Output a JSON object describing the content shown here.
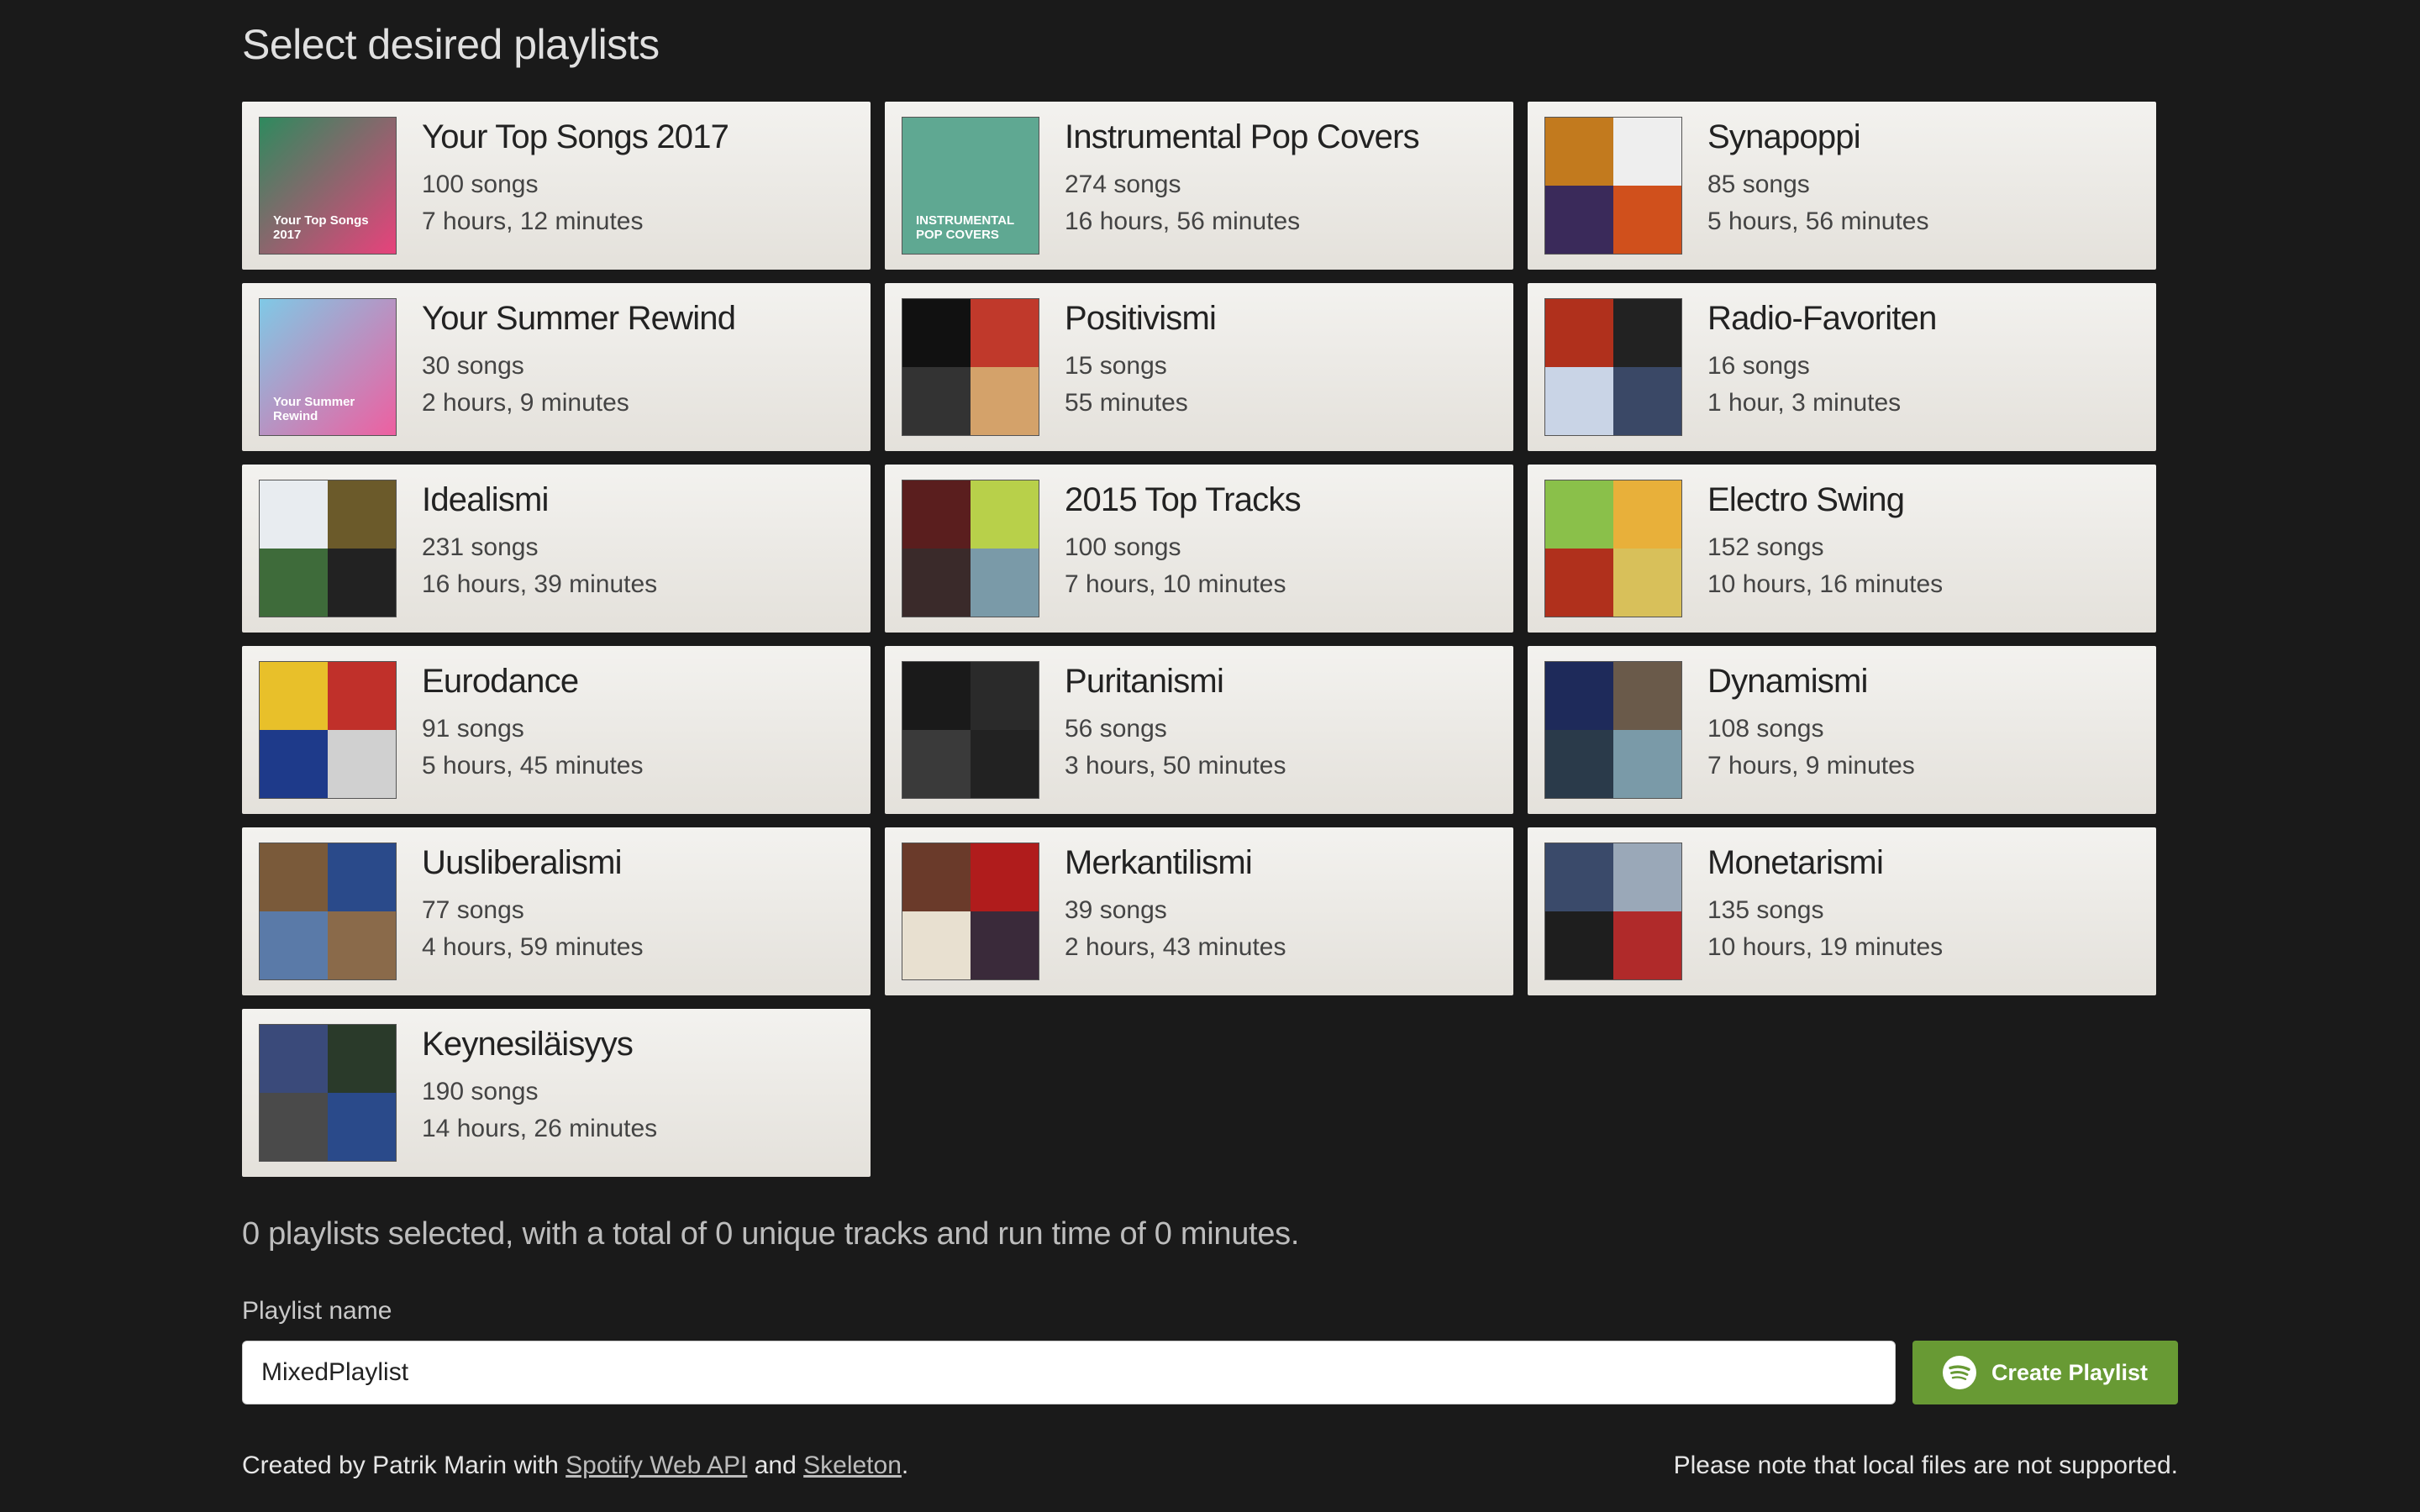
{
  "page": {
    "title": "Select desired playlists"
  },
  "playlists": [
    {
      "name": "Your Top Songs 2017",
      "songs": "100 songs",
      "duration": "7 hours, 12 minutes",
      "cover_text": "Your Top Songs 2017",
      "colors": [
        "#2e8a5e",
        "#e8427c",
        "#1d6b47",
        "#f07ba2"
      ]
    },
    {
      "name": "Instrumental Pop Covers",
      "songs": "274 songs",
      "duration": "16 hours, 56 minutes",
      "cover_text": "INSTRUMENTAL POP COVERS",
      "colors": [
        "#5fa892",
        "#5fa892",
        "#5fa892",
        "#5fa892"
      ]
    },
    {
      "name": "Synapoppi",
      "songs": "85 songs",
      "duration": "5 hours, 56 minutes",
      "colors": [
        "#c27a1e",
        "#eeeeee",
        "#3a2a5a",
        "#d0501c"
      ]
    },
    {
      "name": "Your Summer Rewind",
      "songs": "30 songs",
      "duration": "2 hours, 9 minutes",
      "cover_text": "Your Summer Rewind",
      "colors": [
        "#7fc9e6",
        "#ee5fa0",
        "#9fd6ee",
        "#f4a3c4"
      ]
    },
    {
      "name": "Positivismi",
      "songs": "15 songs",
      "duration": "55 minutes",
      "colors": [
        "#111111",
        "#c0392b",
        "#333333",
        "#d4a26a"
      ]
    },
    {
      "name": "Radio-Favoriten",
      "songs": "16 songs",
      "duration": "1 hour, 3 minutes",
      "colors": [
        "#b0301c",
        "#222222",
        "#c9d4e6",
        "#3a4866"
      ]
    },
    {
      "name": "Idealismi",
      "songs": "231 songs",
      "duration": "16 hours, 39 minutes",
      "colors": [
        "#e8ecf0",
        "#6b5a2a",
        "#3e6b3a",
        "#222222"
      ]
    },
    {
      "name": "2015 Top Tracks",
      "songs": "100 songs",
      "duration": "7 hours, 10 minutes",
      "colors": [
        "#5a1e1e",
        "#b8d04a",
        "#3a2a2a",
        "#7a9aa8"
      ]
    },
    {
      "name": "Electro Swing",
      "songs": "152 songs",
      "duration": "10 hours, 16 minutes",
      "colors": [
        "#8ac04a",
        "#e8b03a",
        "#b0301c",
        "#d8c05a"
      ]
    },
    {
      "name": "Eurodance",
      "songs": "91 songs",
      "duration": "5 hours, 45 minutes",
      "colors": [
        "#e8c02a",
        "#c0302a",
        "#1e3a8a",
        "#d0d0d0"
      ]
    },
    {
      "name": "Puritanismi",
      "songs": "56 songs",
      "duration": "3 hours, 50 minutes",
      "colors": [
        "#1a1a1a",
        "#2a2a2a",
        "#3a3a3a",
        "#222222"
      ]
    },
    {
      "name": "Dynamismi",
      "songs": "108 songs",
      "duration": "7 hours, 9 minutes",
      "colors": [
        "#1e2a5a",
        "#6a5a4a",
        "#2a3a4a",
        "#7a9aa8"
      ]
    },
    {
      "name": "Uusliberalismi",
      "songs": "77 songs",
      "duration": "4 hours, 59 minutes",
      "colors": [
        "#7a5a3a",
        "#2a4a8a",
        "#5a7aa8",
        "#8a6a4a"
      ]
    },
    {
      "name": "Merkantilismi",
      "songs": "39 songs",
      "duration": "2 hours, 43 minutes",
      "colors": [
        "#6a3a2a",
        "#b01c1c",
        "#e8e0d0",
        "#3a2a3a"
      ]
    },
    {
      "name": "Monetarismi",
      "songs": "135 songs",
      "duration": "10 hours, 19 minutes",
      "colors": [
        "#3a4a6a",
        "#9aa8b8",
        "#1e1e1e",
        "#b02a2a"
      ]
    },
    {
      "name": "Keynesiläisyys",
      "songs": "190 songs",
      "duration": "14 hours, 26 minutes",
      "colors": [
        "#3a4a7a",
        "#2a3a2a",
        "#4a4a4a",
        "#2a4a8a"
      ]
    }
  ],
  "summary": "0 playlists selected, with a total of 0 unique tracks and run time of 0 minutes.",
  "form": {
    "label": "Playlist name",
    "value": "MixedPlaylist",
    "button_label": "Create Playlist",
    "button_icon": "spotify-icon",
    "accent": "#689a34"
  },
  "footer": {
    "prefix": "Created by Patrik Marin with",
    "link1": "Spotify Web API",
    "middle": "and",
    "link2": "Skeleton",
    "suffix": ".",
    "note": "Please note that local files are not supported."
  }
}
